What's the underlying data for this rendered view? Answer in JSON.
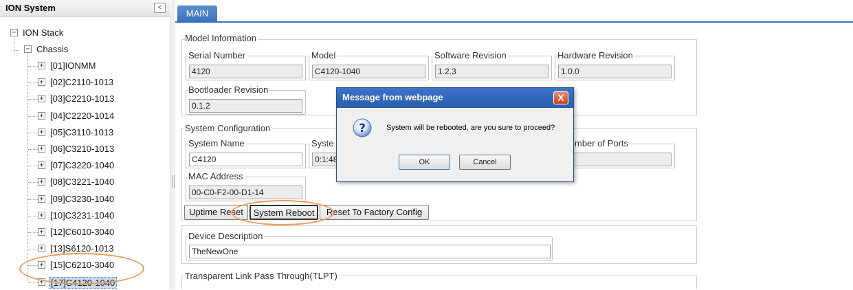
{
  "tree": {
    "title": "ION System",
    "collapse_symbol": "<",
    "root_label": "ION Stack",
    "chassis_label": "Chassis",
    "expand_symbol": "+",
    "collapse_node_symbol": "−",
    "items": [
      {
        "label": "[01]IONMM"
      },
      {
        "label": "[02]C2110-1013"
      },
      {
        "label": "[03]C2210-1013"
      },
      {
        "label": "[04]C2220-1014"
      },
      {
        "label": "[05]C3110-1013"
      },
      {
        "label": "[06]C3210-1013"
      },
      {
        "label": "[07]C3220-1040"
      },
      {
        "label": "[08]C3221-1040"
      },
      {
        "label": "[09]C3230-1040"
      },
      {
        "label": "[10]C3231-1040"
      },
      {
        "label": "[12]C6010-3040"
      },
      {
        "label": "[13]S6120-1013"
      },
      {
        "label": "[15]C6210-3040"
      },
      {
        "label": "[17]C4120-1040"
      }
    ],
    "selected_index": 13
  },
  "main": {
    "tab_label": "MAIN",
    "model_info": {
      "legend": "Model Information",
      "serial_label": "Serial Number",
      "serial_value": "4120",
      "model_label": "Model",
      "model_value": "C4120-1040",
      "software_label": "Software Revision",
      "software_value": "1.2.3",
      "hardware_label": "Hardware Revision",
      "hardware_value": "1.0.0",
      "bootloader_label": "Bootloader Revision",
      "bootloader_value": "0.1.2"
    },
    "system_config": {
      "legend": "System Configuration",
      "name_label": "System Name",
      "name_value": "C4120",
      "uptime_label": "Syste",
      "uptime_value": "0:1:48",
      "ports_label": "mber of Ports",
      "ports_value": "",
      "mac_label": "MAC Address",
      "mac_value": "00-C0-F2-00-D1-14",
      "uptime_reset_button": "Uptime Reset",
      "reboot_button": "System Reboot",
      "factory_button": "Reset To Factory Config"
    },
    "device_desc": {
      "label": "Device Description",
      "value": "TheNewOne"
    },
    "tlpt": {
      "legend": "Transparent Link Pass Through(TLPT)"
    }
  },
  "dialog": {
    "title": "Message from webpage",
    "close_symbol": "X",
    "icon": "question-icon",
    "message": "System will be rebooted, are you sure to proceed?",
    "ok_label": "OK",
    "cancel_label": "Cancel"
  },
  "colors": {
    "tab_blue": "#3a72b9",
    "dialog_title_blue": "#2a5cab",
    "highlight_orange": "#f29a55",
    "selected_item": "#c7dcf1"
  }
}
